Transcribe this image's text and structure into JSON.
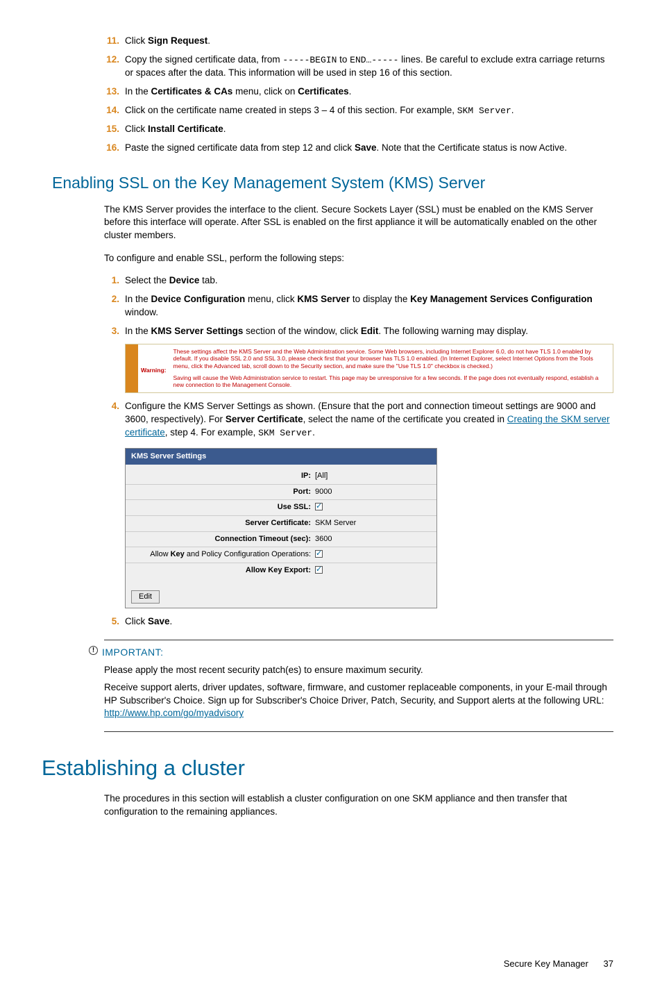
{
  "steps_a": [
    {
      "n": "11.",
      "parts": [
        "Click ",
        {
          "b": "Sign Request"
        },
        "."
      ]
    },
    {
      "n": "12.",
      "parts": [
        "Copy the signed certificate data, from ",
        {
          "m": "-----BEGIN"
        },
        " to ",
        {
          "m": "END…-----"
        },
        " lines.  Be careful to exclude extra carriage returns or spaces after the data.  This information will be used in step 16 of this section."
      ]
    },
    {
      "n": "13.",
      "parts": [
        "In the ",
        {
          "b": "Certificates & CAs"
        },
        " menu, click on ",
        {
          "b": "Certificates"
        },
        "."
      ]
    },
    {
      "n": "14.",
      "parts": [
        "Click on the certificate name created in steps 3 – 4 of this section.  For example, ",
        {
          "m": "SKM Server"
        },
        "."
      ]
    },
    {
      "n": "15.",
      "parts": [
        "Click ",
        {
          "b": "Install Certificate"
        },
        "."
      ]
    },
    {
      "n": "16.",
      "parts": [
        "Paste the signed certificate data from step 12 and click ",
        {
          "b": "Save"
        },
        ".  Note that the Certificate status is now Active."
      ]
    }
  ],
  "h2_a": "Enabling SSL on the Key Management System (KMS) Server",
  "para_a": "The KMS Server provides the interface to the client.  Secure Sockets Layer (SSL) must be enabled on the KMS Server before this interface will operate.  After SSL is enabled on the first appliance it will be automatically enabled on the other cluster members.",
  "para_b": "To configure and enable SSL, perform the following steps:",
  "steps_b": [
    {
      "n": "1.",
      "parts": [
        "Select the ",
        {
          "b": "Device"
        },
        " tab."
      ]
    },
    {
      "n": "2.",
      "parts": [
        "In the ",
        {
          "b": "Device Configuration"
        },
        " menu, click ",
        {
          "b": "KMS Server"
        },
        " to display the ",
        {
          "b": "Key Management Services Configuration"
        },
        " window."
      ]
    },
    {
      "n": "3.",
      "parts": [
        "In the ",
        {
          "b": "KMS Server Settings"
        },
        " section of the window, click ",
        {
          "b": "Edit"
        },
        ".  The following warning may display."
      ]
    }
  ],
  "warn": {
    "label": "Warning:",
    "line1": "These settings affect the KMS Server and the Web Administration service. Some Web browsers, including Internet Explorer 6.0, do not have TLS 1.0 enabled by default. If you disable SSL 2.0 and SSL 3.0, please check first that your browser has TLS 1.0 enabled. (In Internet Explorer, select Internet Options from the Tools menu, click the Advanced tab, scroll down to the Security section, and make sure the \"Use TLS 1.0\" checkbox is checked.)",
    "line2": "Saving will cause the Web Administration service to restart. This page may be unresponsive for a few seconds. If the page does not eventually respond, establish a new connection to the Management Console."
  },
  "step4": {
    "n": "4.",
    "pre": "Configure the KMS Server Settings as shown.  (Ensure that the port and connection timeout settings are 9000 and 3600, respectively).  For ",
    "b1": "Server Certificate",
    "mid": ", select the name of the certificate you created in ",
    "link": "Creating the SKM server certificate",
    "post": ", step 4.  For example, ",
    "mono": "SKM Server",
    "end": "."
  },
  "kms": {
    "title": "KMS Server Settings",
    "rows": [
      {
        "k": "IP:",
        "v": "[All]",
        "kb": true
      },
      {
        "k": "Port:",
        "v": "9000",
        "kb": true
      },
      {
        "k": "Use SSL:",
        "v": "_chk",
        "kb": true
      },
      {
        "k": "Server Certificate:",
        "v": "SKM Server",
        "kb": true
      },
      {
        "k": "Connection Timeout (sec):",
        "v": "3600",
        "kb": true
      },
      {
        "k_html": "Allow <b>Key</b> and Policy Configuration Operations:",
        "v": "_chk"
      },
      {
        "k": "Allow Key Export:",
        "v": "_chk",
        "kb": true
      }
    ],
    "edit": "Edit"
  },
  "step5": {
    "n": "5.",
    "parts": [
      "Click ",
      {
        "b": "Save"
      },
      "."
    ]
  },
  "important": {
    "h": "IMPORTANT:",
    "p1": "Please apply the most recent security patch(es) to ensure maximum security.",
    "p2_pre": "Receive support alerts, driver updates, software, firmware, and customer replaceable components, in your E-mail through HP Subscriber's Choice.  Sign up for Subscriber's Choice Driver, Patch, Security, and Support alerts at the following URL: ",
    "p2_link": "http://www.hp.com/go/myadvisory"
  },
  "h1": "Establishing a cluster",
  "para_c": "The procedures in this section will establish a cluster configuration on one SKM appliance and then transfer that configuration to the remaining appliances.",
  "footer_title": "Secure Key Manager",
  "footer_page": "37"
}
